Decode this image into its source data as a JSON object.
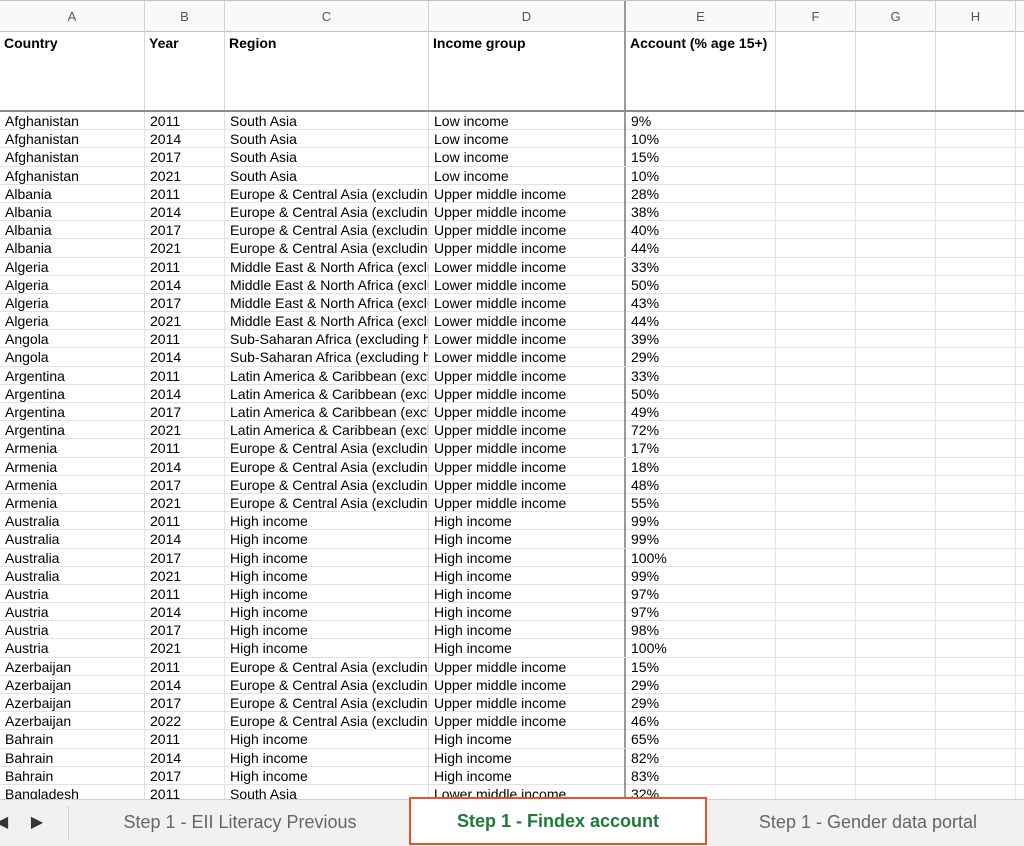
{
  "columns": [
    "A",
    "B",
    "C",
    "D",
    "E",
    "F",
    "G",
    "H"
  ],
  "header": {
    "country": "Country",
    "year": "Year",
    "region": "Region",
    "income": "Income group",
    "account": "Account (% age 15+)"
  },
  "rows": [
    [
      "Afghanistan",
      "2011",
      "South Asia",
      "Low income",
      "9%"
    ],
    [
      "Afghanistan",
      "2014",
      "South Asia",
      "Low income",
      "10%"
    ],
    [
      "Afghanistan",
      "2017",
      "South Asia",
      "Low income",
      "15%"
    ],
    [
      "Afghanistan",
      "2021",
      "South Asia",
      "Low income",
      "10%"
    ],
    [
      "Albania",
      "2011",
      "Europe & Central Asia (excluding high income)",
      "Upper middle income",
      "28%"
    ],
    [
      "Albania",
      "2014",
      "Europe & Central Asia (excluding high income)",
      "Upper middle income",
      "38%"
    ],
    [
      "Albania",
      "2017",
      "Europe & Central Asia (excluding high income)",
      "Upper middle income",
      "40%"
    ],
    [
      "Albania",
      "2021",
      "Europe & Central Asia (excluding high income)",
      "Upper middle income",
      "44%"
    ],
    [
      "Algeria",
      "2011",
      "Middle East & North Africa (excluding high income)",
      "Lower middle income",
      "33%"
    ],
    [
      "Algeria",
      "2014",
      "Middle East & North Africa (excluding high income)",
      "Lower middle income",
      "50%"
    ],
    [
      "Algeria",
      "2017",
      "Middle East & North Africa (excluding high income)",
      "Lower middle income",
      "43%"
    ],
    [
      "Algeria",
      "2021",
      "Middle East & North Africa (excluding high income)",
      "Lower middle income",
      "44%"
    ],
    [
      "Angola",
      "2011",
      "Sub-Saharan Africa (excluding high income)",
      "Lower middle income",
      "39%"
    ],
    [
      "Angola",
      "2014",
      "Sub-Saharan Africa (excluding high income)",
      "Lower middle income",
      "29%"
    ],
    [
      "Argentina",
      "2011",
      "Latin America & Caribbean (excluding high income)",
      "Upper middle income",
      "33%"
    ],
    [
      "Argentina",
      "2014",
      "Latin America & Caribbean (excluding high income)",
      "Upper middle income",
      "50%"
    ],
    [
      "Argentina",
      "2017",
      "Latin America & Caribbean (excluding high income)",
      "Upper middle income",
      "49%"
    ],
    [
      "Argentina",
      "2021",
      "Latin America & Caribbean (excluding high income)",
      "Upper middle income",
      "72%"
    ],
    [
      "Armenia",
      "2011",
      "Europe & Central Asia (excluding high income)",
      "Upper middle income",
      "17%"
    ],
    [
      "Armenia",
      "2014",
      "Europe & Central Asia (excluding high income)",
      "Upper middle income",
      "18%"
    ],
    [
      "Armenia",
      "2017",
      "Europe & Central Asia (excluding high income)",
      "Upper middle income",
      "48%"
    ],
    [
      "Armenia",
      "2021",
      "Europe & Central Asia (excluding high income)",
      "Upper middle income",
      "55%"
    ],
    [
      "Australia",
      "2011",
      "High income",
      "High income",
      "99%"
    ],
    [
      "Australia",
      "2014",
      "High income",
      "High income",
      "99%"
    ],
    [
      "Australia",
      "2017",
      "High income",
      "High income",
      "100%"
    ],
    [
      "Australia",
      "2021",
      "High income",
      "High income",
      "99%"
    ],
    [
      "Austria",
      "2011",
      "High income",
      "High income",
      "97%"
    ],
    [
      "Austria",
      "2014",
      "High income",
      "High income",
      "97%"
    ],
    [
      "Austria",
      "2017",
      "High income",
      "High income",
      "98%"
    ],
    [
      "Austria",
      "2021",
      "High income",
      "High income",
      "100%"
    ],
    [
      "Azerbaijan",
      "2011",
      "Europe & Central Asia (excluding high income)",
      "Upper middle income",
      "15%"
    ],
    [
      "Azerbaijan",
      "2014",
      "Europe & Central Asia (excluding high income)",
      "Upper middle income",
      "29%"
    ],
    [
      "Azerbaijan",
      "2017",
      "Europe & Central Asia (excluding high income)",
      "Upper middle income",
      "29%"
    ],
    [
      "Azerbaijan",
      "2022",
      "Europe & Central Asia (excluding high income)",
      "Upper middle income",
      "46%"
    ],
    [
      "Bahrain",
      "2011",
      "High income",
      "High income",
      "65%"
    ],
    [
      "Bahrain",
      "2014",
      "High income",
      "High income",
      "82%"
    ],
    [
      "Bahrain",
      "2017",
      "High income",
      "High income",
      "83%"
    ],
    [
      "Bangladesh",
      "2011",
      "South Asia",
      "Lower middle income",
      "32%"
    ]
  ],
  "tabs": {
    "prev_icon": "caret-left-icon",
    "next_icon": "caret-right-icon",
    "items": [
      {
        "label": "Step 1 - EII Literacy Previous",
        "active": false
      },
      {
        "label": "Step 1 - Findex account",
        "active": true
      },
      {
        "label": "Step 1 - Gender data portal",
        "active": false
      }
    ]
  },
  "colors": {
    "active_tab_text": "#1d7a3a",
    "active_tab_border": "#e8532d"
  }
}
